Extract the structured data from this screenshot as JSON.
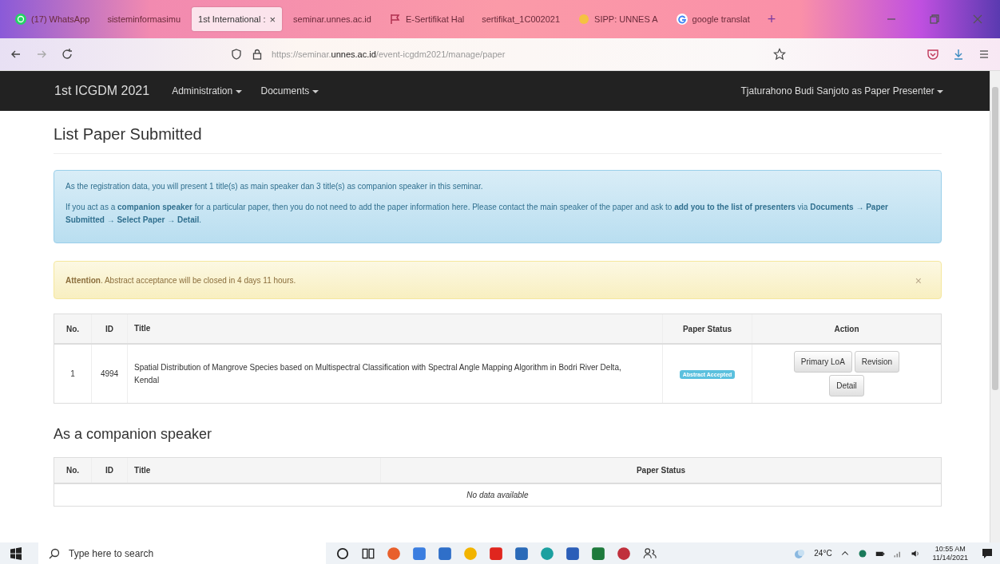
{
  "browser": {
    "tabs": [
      {
        "label": "(17) WhatsApp",
        "selected": false
      },
      {
        "label": "sisteminformasimu",
        "selected": false
      },
      {
        "label": "1st International :",
        "selected": true
      },
      {
        "label": "seminar.unnes.ac.id",
        "selected": false
      },
      {
        "label": "E-Sertifikat Hal",
        "selected": false
      },
      {
        "label": "sertifikat_1C002021",
        "selected": false
      },
      {
        "label": "SIPP: UNNES A",
        "selected": false
      },
      {
        "label": "google translat",
        "selected": false
      }
    ],
    "close_glyph": "×",
    "new_tab_glyph": "+",
    "url": {
      "prefix": "https://seminar.",
      "domain": "unnes.ac.id",
      "path": "/event-icgdm2021/manage/paper"
    }
  },
  "navbar": {
    "brand": "1st ICGDM 2021",
    "menus": [
      "Administration",
      "Documents"
    ],
    "user": "Tjaturahono Budi Sanjoto as Paper Presenter"
  },
  "page": {
    "title": "List Paper Submitted",
    "info": [
      "As the registration data, you will present 1 title(s) as main speaker dan 3 title(s) as companion speaker in this seminar.",
      "If you act as a **companion speaker** for a particular paper, then you do not need to add the paper information here. Please contact the main speaker of the paper and ask to **add you to the list of presenters** via **Documents → Paper Submitted → Select Paper → Detail**."
    ],
    "warning": {
      "text": "**Attention**. Abstract acceptance will be closed in 4 days 11 hours.",
      "close": "×"
    },
    "table": {
      "columns": [
        "No.",
        "ID",
        "Title",
        "Paper Status",
        "Action"
      ],
      "rows": [
        {
          "no": "1",
          "id": "4994",
          "title": "Spatial Distribution of Mangrove Species based on Multispectral Classification with Spectral Angle Mapping Algorithm in Bodri River Delta, Kendal",
          "status": "Abstract Accepted",
          "actions": [
            "Primary LoA",
            "Revision",
            "Detail"
          ]
        }
      ]
    },
    "companion_title": "As a companion speaker",
    "companion_table": {
      "columns": [
        "No.",
        "ID",
        "Title",
        "Paper Status"
      ],
      "empty": "No data available"
    }
  },
  "taskbar": {
    "search_placeholder": "Type here to search",
    "weather": "24°C",
    "time": "10:55 AM",
    "date": "11/14/2021"
  }
}
